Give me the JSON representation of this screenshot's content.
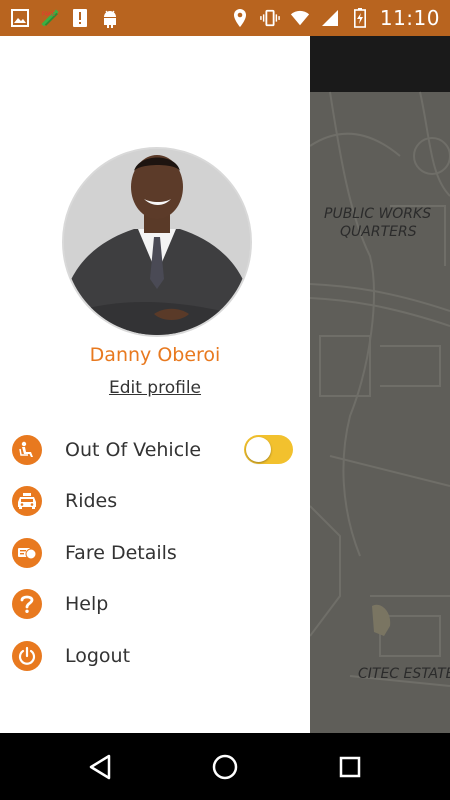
{
  "status_bar": {
    "time": "11:10",
    "left_icons": [
      "image-icon",
      "fake-gps-icon",
      "alert-icon",
      "android-icon"
    ],
    "right_icons": [
      "location-icon",
      "vibrate-icon",
      "wifi-icon",
      "signal-icon",
      "battery-icon"
    ],
    "background": "#b8641f"
  },
  "map": {
    "labels": {
      "public_works_line1": "PUBLIC WORKS",
      "public_works_line2": "QUARTERS",
      "citec": "CITEC ESTATE"
    }
  },
  "drawer": {
    "user": {
      "name": "Danny Oberoi",
      "edit_profile": "Edit profile",
      "avatar_icon": "profile-photo"
    },
    "menu": [
      {
        "label": "Out Of Vehicle",
        "icon": "seat-icon",
        "has_toggle": true,
        "toggle_on": true
      },
      {
        "label": "Rides",
        "icon": "car-icon"
      },
      {
        "label": "Fare Details",
        "icon": "fare-icon"
      },
      {
        "label": "Help",
        "icon": "help-icon"
      },
      {
        "label": "Logout",
        "icon": "power-icon"
      }
    ],
    "accent_color": "#e8791f",
    "toggle_color": "#f2c12e"
  },
  "nav_bar": {
    "buttons": [
      "back-icon",
      "home-icon",
      "recents-icon"
    ]
  }
}
